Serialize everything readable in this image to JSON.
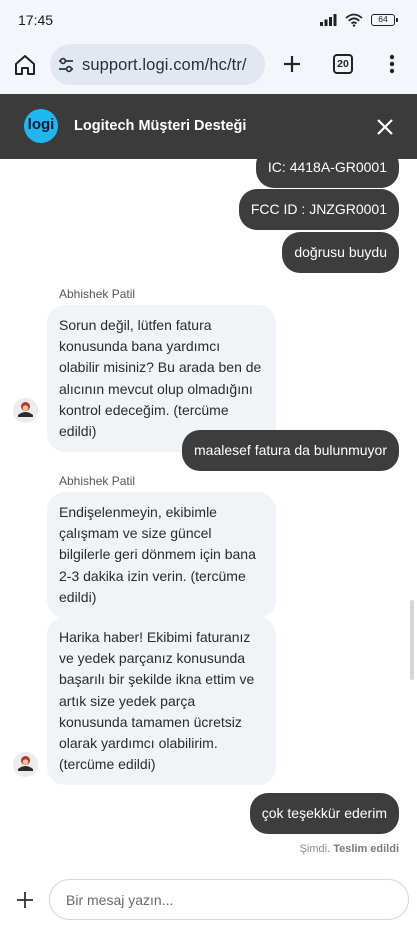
{
  "status_bar": {
    "time": "17:45",
    "battery": "64"
  },
  "browser": {
    "url": "support.logi.com/hc/tr/",
    "tab_count": "20"
  },
  "chat_header": {
    "logo_text": "logi",
    "title": "Logitech Müşteri Desteği"
  },
  "messages": {
    "user_1": "IC: 4418A-GR0001",
    "user_2": "FCC ID : JNZGR0001",
    "user_3": "doğrusu buydu",
    "agent_name_1": "Abhishek Patil",
    "agent_1": "Sorun değil, lütfen fatura konusunda bana yardımcı olabilir misiniz? Bu arada ben de alıcının mevcut olup olmadığını kontrol edeceğim. (tercüme edildi)",
    "user_4": "maalesef fatura da bulunmuyor",
    "agent_name_2": "Abhishek Patil",
    "agent_2": "Endişelenmeyin, ekibimle çalışmam ve size güncel bilgilerle geri dönmem için bana 2-3 dakika izin verin. (tercüme edildi)",
    "agent_3": "Harika haber! Ekibimi faturanız ve yedek parçanız konusunda başarılı bir şekilde ikna ettim ve artık size yedek parça konusunda tamamen ücretsiz olarak yardımcı olabilirim. (tercüme edildi)",
    "user_5": "çok teşekkür ederim",
    "delivery_time": "Şimdi.",
    "delivery_status": "Teslim edildi"
  },
  "composer": {
    "placeholder": "Bir mesaj yazın..."
  },
  "colors": {
    "header_bg": "#3b3b3b",
    "user_bubble": "#3d3d3d",
    "agent_bubble": "#f2f3f7",
    "logo": "#1fb6f2"
  },
  "icons": [
    "home-icon",
    "site-settings-icon",
    "new-tab-icon",
    "tab-switcher-icon",
    "more-menu-icon",
    "close-icon",
    "attach-plus-icon"
  ]
}
